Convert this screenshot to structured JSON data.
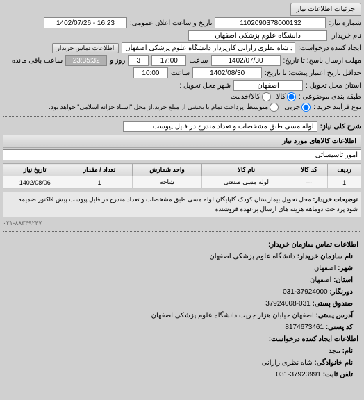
{
  "header": {
    "tab": "جزئیات اطلاعات نیاز"
  },
  "form": {
    "req_number_label": "شماره نیاز:",
    "req_number": "1102090378000132",
    "announce_label": "تاریخ و ساعت اعلان عمومی:",
    "announce_value": "1402/07/26 - 16:23",
    "buyer_label": "نام خریدار:",
    "buyer": "دانشگاه علوم پزشکی اصفهان",
    "creator_label": "ایجاد کننده درخواست:",
    "creator": "مجد شاه نظری زارانی کارپرداز دانشگاه علوم پزشکی اصفهان",
    "contact_btn": "اطلاعات تماس خریدار",
    "deadline_label": "مهلت ارسال پاسخ: تا تاریخ:",
    "deadline_date": "1402/07/30",
    "saat_label": "ساعت",
    "deadline_time": "17:00",
    "days_val": "3",
    "days_label": "روز و",
    "remaining_time": "23:35:32",
    "remaining_label": "ساعت باقی مانده",
    "validity_label": "حداقل تاریخ اعتبار پیشت: تا تاریخ:",
    "validity_date": "1402/08/30",
    "validity_time": "10:00",
    "province_label": "استان محل تحویل :",
    "province": "اصفهان",
    "city_label": "شهر محل تحویل :",
    "category_label": "طبقه بندی موضوعی :",
    "kala": "کالا",
    "khadamat": "کالا/خدمت",
    "buy_type_label": "نوع فرآیند خرید :",
    "jozi": "جزیی",
    "motavaset": "متوسط",
    "buy_type_note": "پرداخت تمام یا بخشی از مبلغ خرید،از محل \"اسناد خزانه اسلامی\" خواهد بود.",
    "desc_label": "شرح کلی نیاز:",
    "desc": "لوله مسی طبق مشخصات و تعداد مندرج در فایل پیوست",
    "goods_title": "اطلاعات کالاهای مورد نیاز",
    "statistical": "امور تاسیساتی"
  },
  "table": {
    "headers": [
      "ردیف",
      "کد کالا",
      "نام کالا",
      "واحد شمارش",
      "تعداد / مقدار",
      "تاریخ نیاز"
    ],
    "rows": [
      {
        "idx": "1",
        "code": "---",
        "name": "لوله مسی صنعتی",
        "unit": "شاخه",
        "qty": "1",
        "date": "1402/08/06"
      }
    ]
  },
  "notes": {
    "buyer_notes_label": "توضیحات خریدار:",
    "buyer_notes": "محل تحویل بیمارستان کودک گلپایگان لوله مسی طبق مشخصات و تعداد مندرج در فایل پیوست پیش فاکتور ضمیمه شود پرداخت دوماهه هزینه های ارسال برعهده فروشنده",
    "footer": "۰۲۱-۸۸۳۴۹۲۴۷"
  },
  "contact": {
    "title": "اطلاعات تماس سازمان خریدار:",
    "org_label": "نام سازمان خریدار:",
    "org": "دانشگاه علوم پزشکی اصفهان",
    "city_label": "شهر:",
    "city": "اصفهان",
    "province_label": "استان:",
    "province": "اصفهان",
    "fax_label": "دورنگار:",
    "fax": "031-37924000",
    "postbox_label": "صندوق پستی:",
    "postbox": "37924008-031",
    "address_label": "آدرس پستی:",
    "address": "اصفهان خیابان هزار جریب دانشگاه علوم پزشکی اصفهان",
    "postcode_label": "کد پستی:",
    "postcode": "8174673461",
    "creator_title": "اطلاعات ایجاد کننده درخواست:",
    "name_label": "نام:",
    "name": "مجد",
    "family_label": "نام خانوادگی:",
    "family": "شاه نظری زارانی",
    "phone_label": "تلفن ثابت:",
    "phone": "031-37923991"
  }
}
